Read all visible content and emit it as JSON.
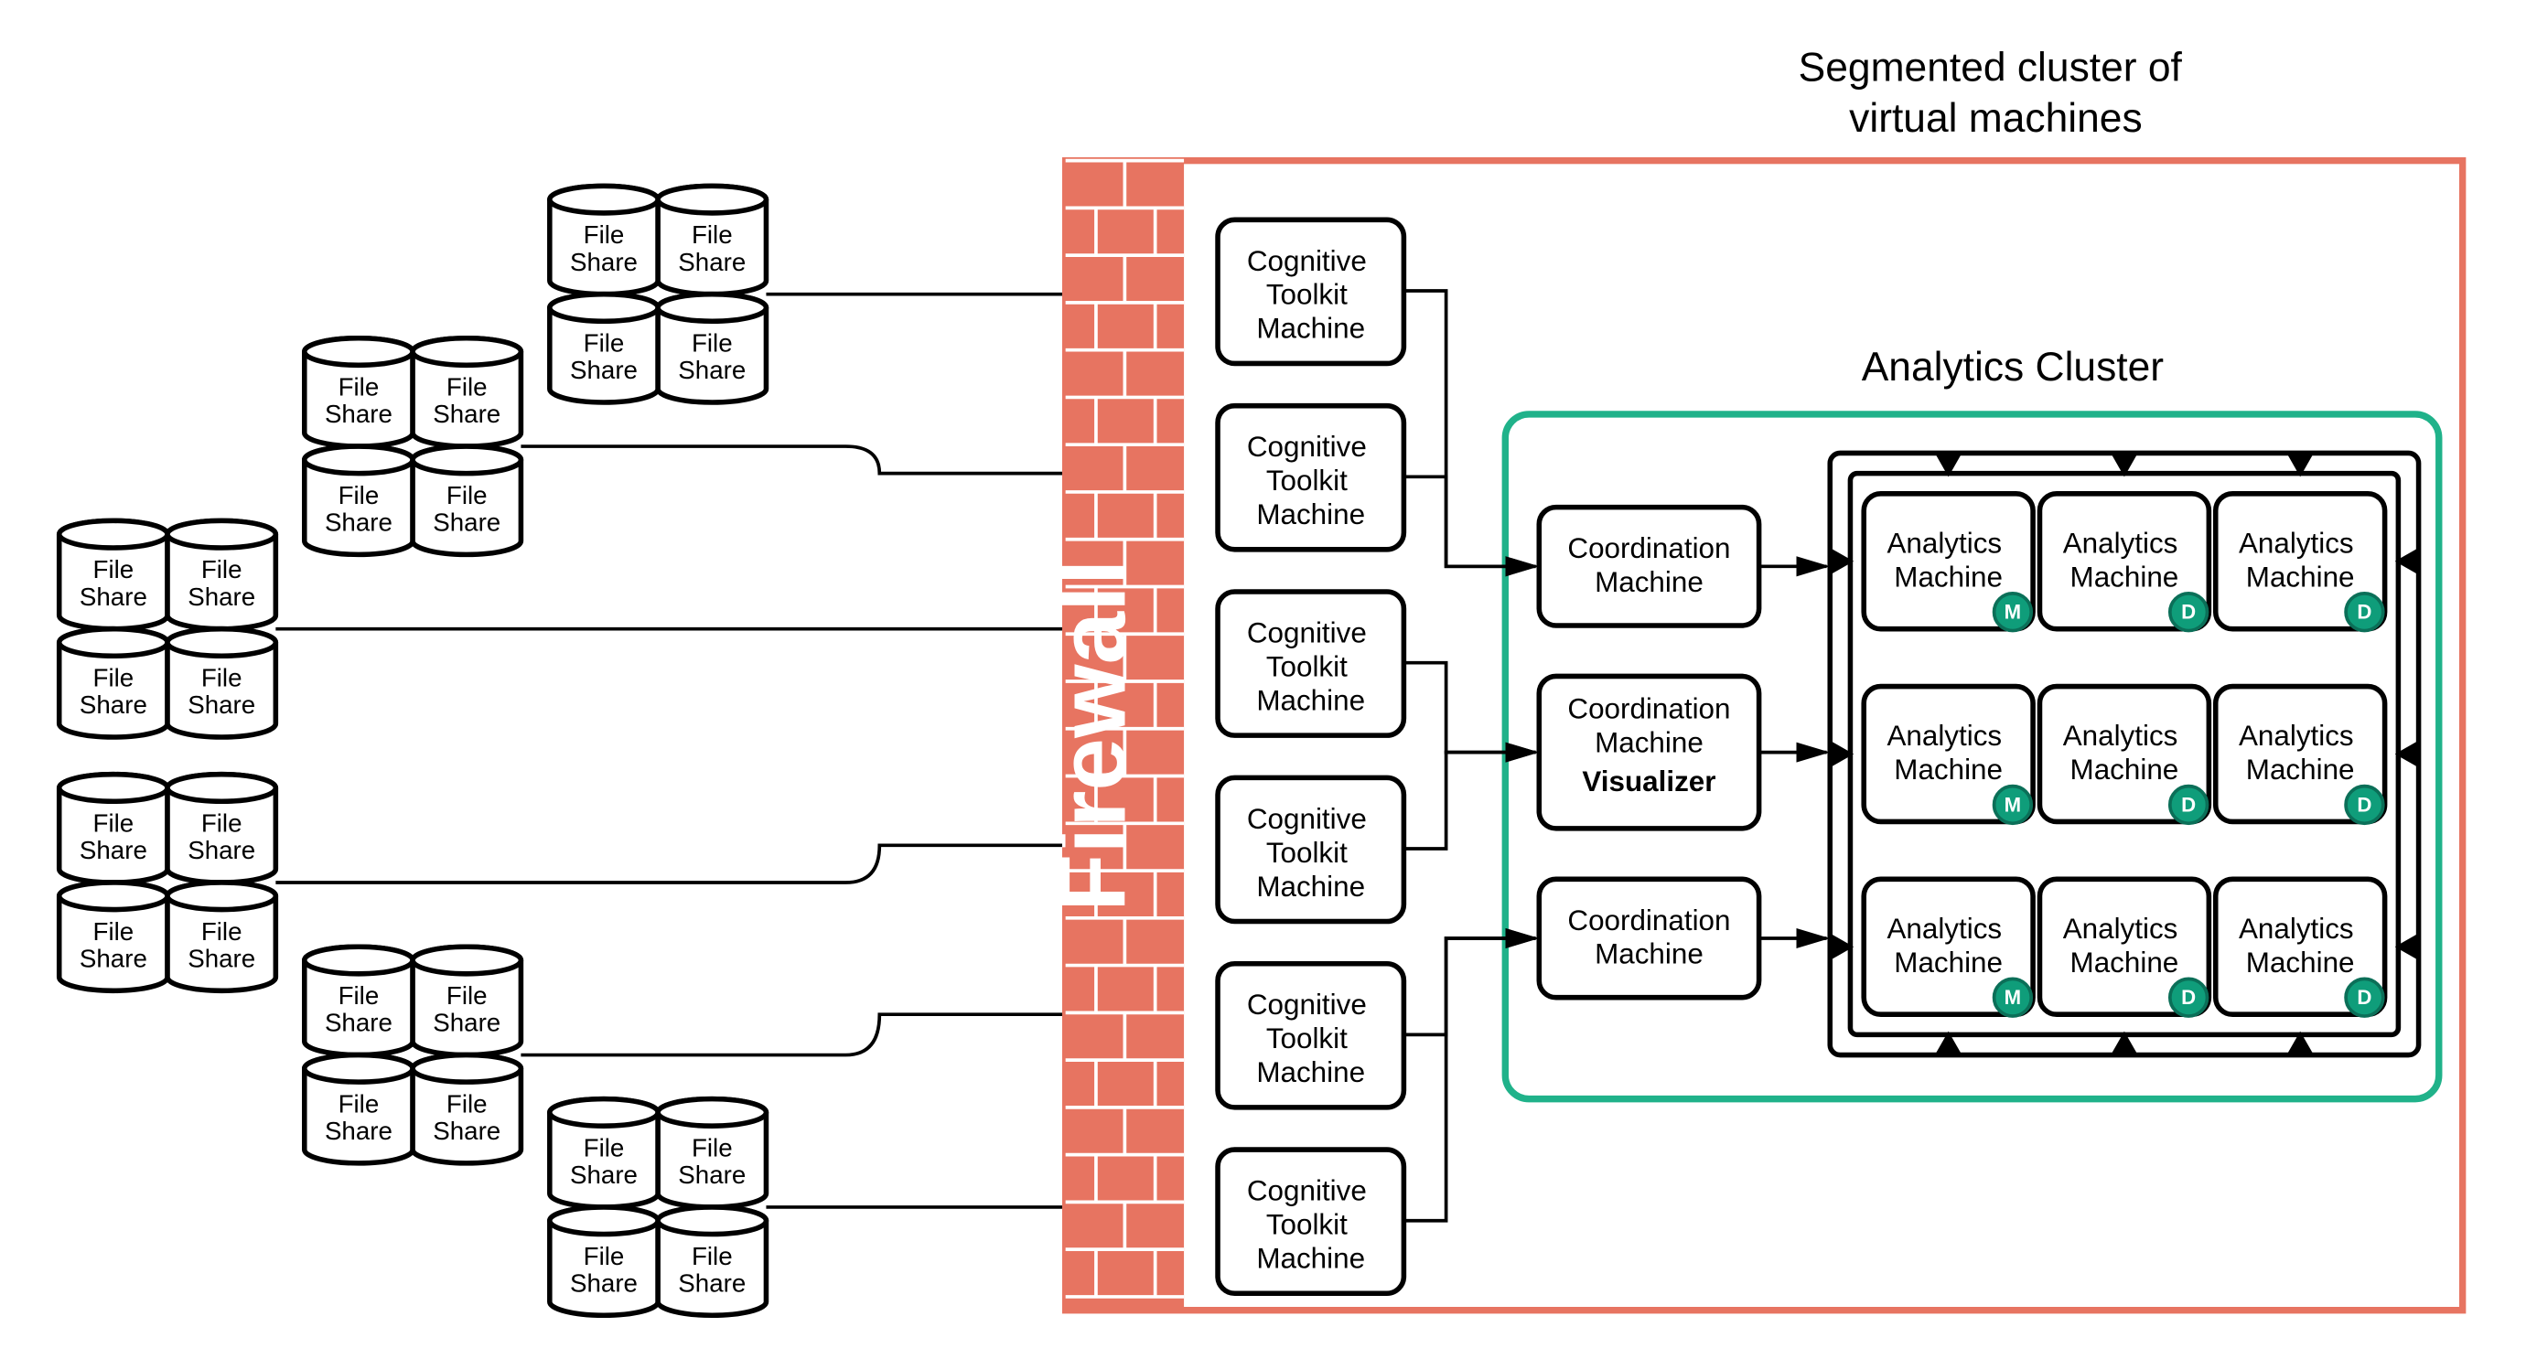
{
  "cluster_title_l1": "Segmented cluster of",
  "cluster_title_l2": "virtual machines",
  "analytics_title": "Analytics Cluster",
  "firewall": "Firewall",
  "file_share_l1": "File",
  "file_share_l2": "Share",
  "cognitive_l1": "Cognitive",
  "cognitive_l2": "Toolkit",
  "cognitive_l3": "Machine",
  "coord_l1": "Coordination",
  "coord_l2": "Machine",
  "coord_vis": "Visualizer",
  "analytics_l1": "Analytics",
  "analytics_l2": "Machine",
  "badge_m": "M",
  "badge_d": "D"
}
